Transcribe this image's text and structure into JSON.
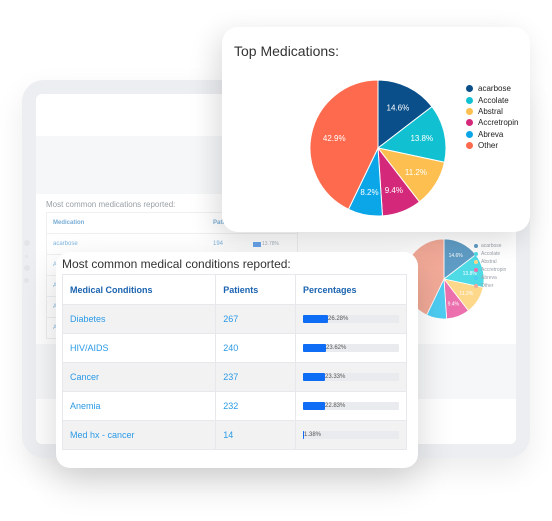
{
  "background_dashboard": {
    "medications_title": "Most common medications reported:",
    "medications_table": {
      "headers": [
        "Medication",
        "Patients",
        ""
      ],
      "rows": [
        {
          "medication": "acarbose",
          "patients": "194",
          "percentage": "13.78%",
          "fraction": 0.1378
        },
        {
          "medication": "A",
          "patients": "",
          "percentage": "",
          "fraction": 0
        },
        {
          "medication": "A",
          "patients": "",
          "percentage": "",
          "fraction": 0
        },
        {
          "medication": "A",
          "patients": "",
          "percentage": "",
          "fraction": 0
        },
        {
          "medication": "A",
          "patients": "",
          "percentage": "",
          "fraction": 0
        }
      ]
    }
  },
  "top_medications": {
    "title": "Top Medications:"
  },
  "chart_data": [
    {
      "type": "pie",
      "title": "Top Medications:",
      "categories": [
        "acarbose",
        "Accolate",
        "Abstral",
        "Accretropin",
        "Abreva",
        "Other"
      ],
      "values": [
        14.6,
        13.8,
        11.2,
        9.4,
        8.2,
        42.9
      ],
      "labels": [
        "14.6%",
        "13.8%",
        "11.2%",
        "9.4%",
        "8.2%",
        "42.9%"
      ],
      "colors": [
        "#0b4f8a",
        "#12c1d1",
        "#fdbf4f",
        "#d4297a",
        "#0aa6e8",
        "#fd6a4d"
      ],
      "legend": "right"
    },
    {
      "type": "pie",
      "title": "",
      "categories": [
        "acarbose",
        "Accolate",
        "Abstral",
        "Accretropin",
        "Abreva",
        "Other"
      ],
      "values": [
        14.6,
        13.8,
        11.2,
        9.4,
        8.2,
        42.9
      ],
      "labels": [
        "14.6%",
        "13.8%",
        "11.2%",
        "9.4%",
        "",
        ""
      ],
      "colors": [
        "#5f9cc5",
        "#4fdbe6",
        "#fdd88a",
        "#ec70ae",
        "#4dcdf2",
        "#f3aa98"
      ],
      "legend": "right"
    }
  ],
  "conditions": {
    "title": "Most common medical conditions reported:",
    "headers": [
      "Medical Conditions",
      "Patients",
      "Percentages"
    ],
    "rows": [
      {
        "condition": "Diabetes",
        "patients": "267",
        "percentage": "26.28%",
        "fraction": 0.2628
      },
      {
        "condition": "HIV/AIDS",
        "patients": "240",
        "percentage": "23.62%",
        "fraction": 0.2362
      },
      {
        "condition": "Cancer",
        "patients": "237",
        "percentage": "23.33%",
        "fraction": 0.2333
      },
      {
        "condition": "Anemia",
        "patients": "232",
        "percentage": "22.83%",
        "fraction": 0.2283
      },
      {
        "condition": "Med hx - cancer",
        "patients": "14",
        "percentage": "1.38%",
        "fraction": 0.0138
      }
    ]
  }
}
